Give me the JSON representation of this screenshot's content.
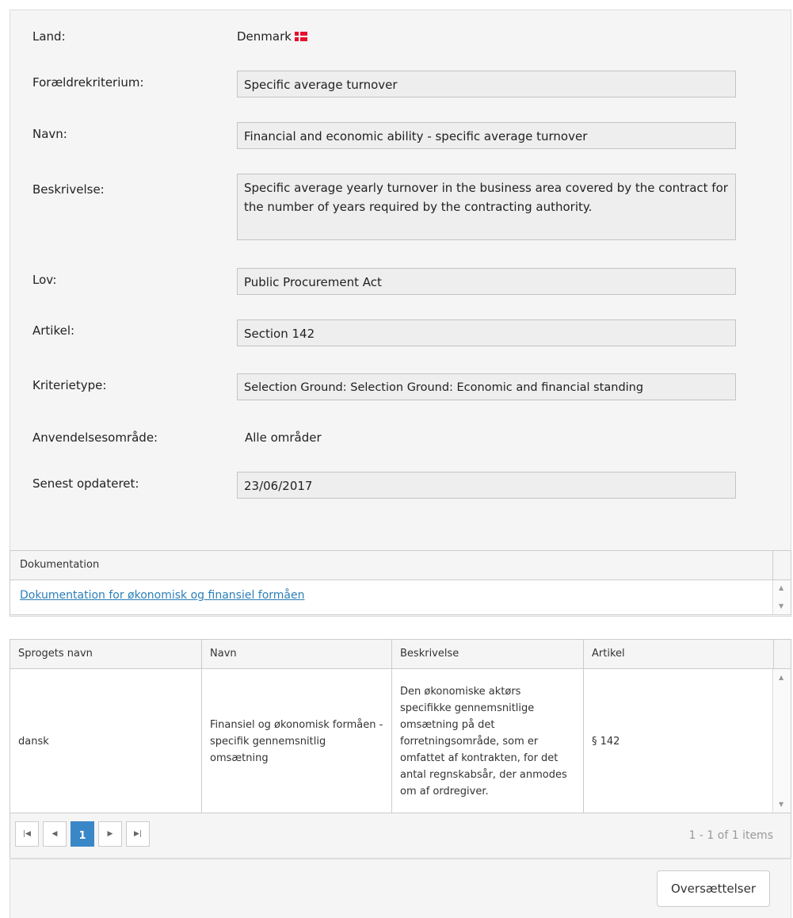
{
  "fields": {
    "land": {
      "label": "Land:",
      "value": "Denmark"
    },
    "parent": {
      "label": "Forældrekriterium:",
      "value": "Specific average turnover"
    },
    "name": {
      "label": "Navn:",
      "value": "Financial and economic ability - specific average turnover"
    },
    "description": {
      "label": "Beskrivelse:",
      "value": "Specific average yearly turnover in the business area covered by the contract for the number of years required by the contracting authority."
    },
    "law": {
      "label": "Lov:",
      "value": "Public Procurement Act"
    },
    "article": {
      "label": "Artikel:",
      "value": "Section 142"
    },
    "criterion_type": {
      "label": "Kriterietype:",
      "value": "Selection Ground: Selection Ground: Economic and financial standing"
    },
    "scope": {
      "label": "Anvendelsesområde:",
      "value": "Alle områder"
    },
    "updated": {
      "label": "Senest opdateret:",
      "value": "23/06/2017"
    }
  },
  "documentation": {
    "header": "Dokumentation",
    "link": "Dokumentation for økonomisk og finansiel formåen"
  },
  "translations": {
    "columns": [
      "Sprogets navn",
      "Navn",
      "Beskrivelse",
      "Artikel"
    ],
    "rows": [
      {
        "language": "dansk",
        "name": "Finansiel og økonomisk formåen - specifik gennemsnitlig omsætning",
        "description": "Den økonomiske aktørs specifikke gennemsnitlige omsætning på det forretningsområde, som er omfattet af kontrakten, for det antal regnskabsår, der anmodes om af ordregiver.",
        "article": "§ 142"
      }
    ],
    "pager": {
      "current_page": "1",
      "info": "1 - 1 of 1 items"
    }
  },
  "buttons": {
    "translations": "Oversættelser"
  },
  "colors": {
    "accent": "#3a87c8",
    "link": "#2b7fb9",
    "flag": "#e3122d"
  }
}
